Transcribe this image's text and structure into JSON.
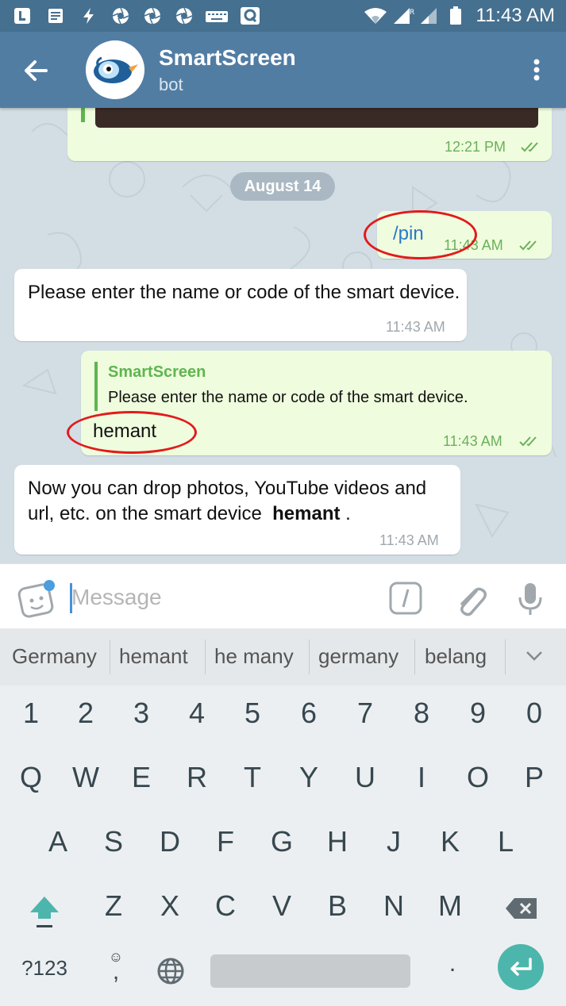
{
  "status_bar": {
    "time": "11:43 AM",
    "icons": [
      "l-app-icon",
      "notes-icon",
      "flash-icon",
      "aperture-icon",
      "aperture-icon",
      "aperture-icon",
      "keyboard-icon",
      "q-app-icon",
      "wifi-icon",
      "signal-roaming-icon",
      "signal-icon",
      "battery-icon"
    ]
  },
  "header": {
    "title": "SmartScreen",
    "subtitle": "bot",
    "back_icon": "arrow-back-icon",
    "menu_icon": "more-vert-icon"
  },
  "chat": {
    "messages": [
      {
        "direction": "outgoing",
        "text": "",
        "time": "12:21 PM",
        "has_image": true
      },
      {
        "kind": "date",
        "text": "August 14"
      },
      {
        "direction": "outgoing",
        "text": "/pin",
        "time": "11:43 AM"
      },
      {
        "direction": "incoming",
        "text": "Please enter the name or code of the smart device.",
        "time": "11:43 AM"
      },
      {
        "direction": "outgoing",
        "reply_to": {
          "name": "SmartScreen",
          "text": "Please enter the name or code of the smart device."
        },
        "text": "hemant",
        "time": "11:43 AM"
      },
      {
        "direction": "incoming",
        "text_before": "Now you can drop photos, YouTube videos and url, etc. on the smart device",
        "bold": "hemant",
        "text_after": ".",
        "time": "11:43 AM"
      }
    ]
  },
  "composer": {
    "placeholder": "Message",
    "sticker_icon": "sticker-icon",
    "command_icon": "slash-command-icon",
    "attach_icon": "paperclip-icon",
    "mic_icon": "microphone-icon"
  },
  "keyboard": {
    "suggestions": [
      "Germany",
      "hemant",
      "he many",
      "germany",
      "belang"
    ],
    "row_numbers": [
      "1",
      "2",
      "3",
      "4",
      "5",
      "6",
      "7",
      "8",
      "9",
      "0"
    ],
    "row_1": [
      "Q",
      "W",
      "E",
      "R",
      "T",
      "Y",
      "U",
      "I",
      "O",
      "P"
    ],
    "row_2": [
      "A",
      "S",
      "D",
      "F",
      "G",
      "H",
      "J",
      "K",
      "L"
    ],
    "row_3": [
      "Z",
      "X",
      "C",
      "V",
      "B",
      "N",
      "M"
    ],
    "symbols_key": "?123",
    "comma_key": ",",
    "period_key": ".",
    "accent_color": "#4db6ac"
  },
  "colors": {
    "header": "#527da3",
    "status_bar": "#46708f",
    "outgoing_bubble": "#effdde",
    "incoming_bubble": "#ffffff",
    "annotation_ring": "#e21b1b"
  }
}
